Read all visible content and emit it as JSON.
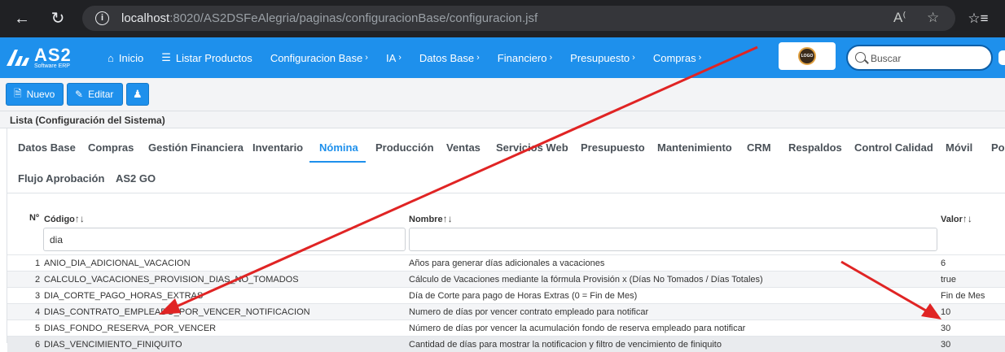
{
  "browser": {
    "url_host": "localhost",
    "url_path": ":8020/AS2DSFeAlegria/paginas/configuracionBase/configuracion.jsf"
  },
  "app": {
    "logo_title": "AS2",
    "logo_subtitle": "Software ERP",
    "logo_badge": "LOGO",
    "menu": [
      {
        "label": "Inicio",
        "icon": "home-icon",
        "chevron": false
      },
      {
        "label": "Listar Productos",
        "icon": "list-icon",
        "chevron": false
      },
      {
        "label": "Configuracion Base",
        "icon": "",
        "chevron": true
      },
      {
        "label": "IA",
        "icon": "",
        "chevron": true
      },
      {
        "label": "Datos Base",
        "icon": "",
        "chevron": true
      },
      {
        "label": "Financiero",
        "icon": "",
        "chevron": true
      },
      {
        "label": "Presupuesto",
        "icon": "",
        "chevron": true
      },
      {
        "label": "Compras",
        "icon": "",
        "chevron": true
      }
    ],
    "search_placeholder": "Buscar",
    "accent_color": "#1e90ec"
  },
  "toolbar": {
    "nuevo_label": "Nuevo",
    "editar_label": "Editar"
  },
  "panel": {
    "title": "Lista (Configuración del Sistema)"
  },
  "tabs": {
    "row1": [
      "Datos Base",
      "Compras",
      "Gestión Financiera",
      "Inventario",
      "Nómina",
      "Producción",
      "Ventas",
      "Servicios Web",
      "Presupuesto",
      "Mantenimiento",
      "CRM",
      "Respaldos",
      "Control Calidad",
      "Móvil",
      "Pos"
    ],
    "row2": [
      "Flujo Aprobación",
      "AS2 GO"
    ],
    "active": "Nómina"
  },
  "table": {
    "headers": {
      "num": "Nº",
      "codigo": "Código",
      "nombre": "Nombre",
      "valor": "Valor"
    },
    "filters": {
      "codigo": "dia",
      "nombre": ""
    },
    "rows": [
      {
        "n": "1",
        "codigo": "ANIO_DIA_ADICIONAL_VACACION",
        "nombre": "Años para generar días adicionales a vacaciones",
        "valor": "6"
      },
      {
        "n": "2",
        "codigo": "CALCULO_VACACIONES_PROVISION_DIAS_NO_TOMADOS",
        "nombre": "Cálculo de Vacaciones mediante la fórmula Provisión x (Días No Tomados / Días Totales)",
        "valor": "true"
      },
      {
        "n": "3",
        "codigo": "DIA_CORTE_PAGO_HORAS_EXTRAS",
        "nombre": "Día de Corte para pago de Horas Extras (0 = Fin de Mes)",
        "valor": "Fin de Mes"
      },
      {
        "n": "4",
        "codigo": "DIAS_CONTRATO_EMPLEADO_POR_VENCER_NOTIFICACION",
        "nombre": "Numero de días por vencer contrato empleado para notificar",
        "valor": "10"
      },
      {
        "n": "5",
        "codigo": "DIAS_FONDO_RESERVA_POR_VENCER",
        "nombre": "Número de días por vencer la acumulación fondo de reserva empleado para notificar",
        "valor": "30"
      },
      {
        "n": "6",
        "codigo": "DIAS_VENCIMIENTO_FINIQUITO",
        "nombre": "Cantidad de días para mostrar la notificacion y filtro de vencimiento de finiquito",
        "valor": "30"
      }
    ]
  },
  "annotation_color": "#e02424"
}
